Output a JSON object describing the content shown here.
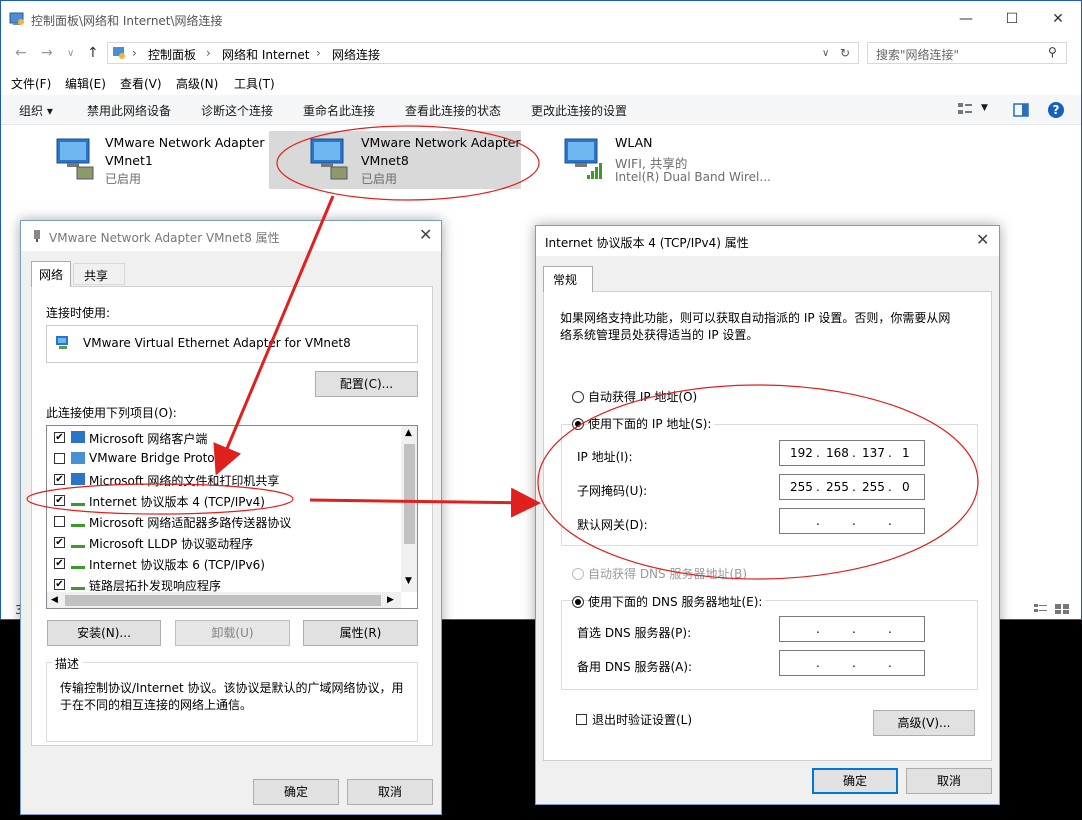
{
  "window": {
    "title": "控制面板\\网络和 Internet\\网络连接",
    "status_count": "3"
  },
  "address": {
    "crumbs": [
      "控制面板",
      "网络和 Internet",
      "网络连接"
    ],
    "search_placeholder": "搜索\"网络连接\""
  },
  "menu": [
    "文件(F)",
    "编辑(E)",
    "查看(V)",
    "高级(N)",
    "工具(T)"
  ],
  "commands": [
    "组织 ▾",
    "禁用此网络设备",
    "诊断这个连接",
    "重命名此连接",
    "查看此连接的状态",
    "更改此连接的设置"
  ],
  "adapters": [
    {
      "name": "VMware Network Adapter",
      "sub": "VMnet1",
      "status": "已启用"
    },
    {
      "name": "VMware Network Adapter",
      "sub": "VMnet8",
      "status": "已启用"
    },
    {
      "name": "WLAN",
      "sub": "WIFI, 共享的",
      "status": "Intel(R) Dual Band Wirel..."
    }
  ],
  "props": {
    "title": "VMware Network Adapter VMnet8 属性",
    "tabs": [
      "网络",
      "共享"
    ],
    "connect_using_label": "连接时使用:",
    "device": "VMware Virtual Ethernet Adapter for VMnet8",
    "configure": "配置(C)...",
    "items_label": "此连接使用下列项目(O):",
    "items": [
      {
        "label": "Microsoft 网络客户端",
        "checked": true
      },
      {
        "label": "VMware Bridge Protocol",
        "checked": false
      },
      {
        "label": "Microsoft 网络的文件和打印机共享",
        "checked": true
      },
      {
        "label": "Internet 协议版本 4 (TCP/IPv4)",
        "checked": true
      },
      {
        "label": "Microsoft 网络适配器多路传送器协议",
        "checked": false
      },
      {
        "label": "Microsoft LLDP 协议驱动程序",
        "checked": true
      },
      {
        "label": "Internet 协议版本 6 (TCP/IPv6)",
        "checked": true
      },
      {
        "label": "链路层拓扑发现响应程序",
        "checked": true
      }
    ],
    "install": "安装(N)...",
    "uninstall": "卸载(U)",
    "properties": "属性(R)",
    "desc_label": "描述",
    "desc_line1": "传输控制协议/Internet 协议。该协议是默认的广域网络协议，用",
    "desc_line2": "于在不同的相互连接的网络上通信。",
    "ok": "确定",
    "cancel": "取消"
  },
  "ipv4": {
    "title": "Internet 协议版本 4 (TCP/IPv4) 属性",
    "tab": "常规",
    "intro1": "如果网络支持此功能，则可以获取自动指派的 IP 设置。否则，你需要从网",
    "intro2": "络系统管理员处获得适当的 IP 设置。",
    "auto_ip": "自动获得 IP 地址(O)",
    "manual_ip": "使用下面的 IP 地址(S):",
    "ip_label": "IP 地址(I):",
    "ip": [
      "192",
      "168",
      "137",
      "1"
    ],
    "mask_label": "子网掩码(U):",
    "mask": [
      "255",
      "255",
      "255",
      "0"
    ],
    "gw_label": "默认网关(D):",
    "auto_dns": "自动获得 DNS 服务器地址(B)",
    "manual_dns": "使用下面的 DNS 服务器地址(E):",
    "dns1_label": "首选 DNS 服务器(P):",
    "dns2_label": "备用 DNS 服务器(A):",
    "validate": "退出时验证设置(L)",
    "advanced": "高级(V)...",
    "ok": "确定",
    "cancel": "取消"
  }
}
